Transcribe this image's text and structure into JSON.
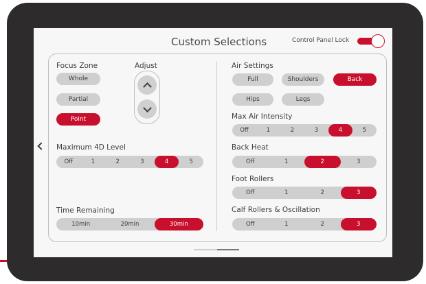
{
  "header": {
    "title": "Custom Selections",
    "lock_label": "Control Panel Lock",
    "lock_on": true
  },
  "focus_zone": {
    "label": "Focus Zone",
    "options": [
      "Whole",
      "Partial",
      "Point"
    ],
    "selected": "Point"
  },
  "adjust": {
    "label": "Adjust"
  },
  "max_4d": {
    "label": "Maximum 4D Level",
    "options": [
      "Off",
      "1",
      "2",
      "3",
      "4",
      "5"
    ],
    "selected": "4"
  },
  "time_remaining": {
    "label": "Time Remaining",
    "options": [
      "10min",
      "20min",
      "30min"
    ],
    "selected": "30min"
  },
  "air_settings": {
    "label": "Air Settings",
    "options": [
      "Full",
      "Shoulders",
      "Back",
      "Hips",
      "Legs"
    ],
    "selected": "Back"
  },
  "max_air": {
    "label": "Max Air Intensity",
    "options": [
      "Off",
      "1",
      "2",
      "3",
      "4",
      "5"
    ],
    "selected": "4"
  },
  "back_heat": {
    "label": "Back Heat",
    "options": [
      "Off",
      "1",
      "2",
      "3"
    ],
    "selected": "2"
  },
  "foot_rollers": {
    "label": "Foot Rollers",
    "options": [
      "Off",
      "1",
      "2",
      "3"
    ],
    "selected": "3"
  },
  "calf_rollers": {
    "label": "Calf Rollers & Oscillation",
    "options": [
      "Off",
      "1",
      "2",
      "3"
    ],
    "selected": "3"
  },
  "colors": {
    "accent": "#c8102e",
    "pill": "#cfcfcf",
    "bezel": "#2d2b2c",
    "screen": "#f7f7f7"
  },
  "icons": {
    "back": "chevron-left-icon",
    "up": "chevron-up-icon",
    "down": "chevron-down-icon"
  }
}
